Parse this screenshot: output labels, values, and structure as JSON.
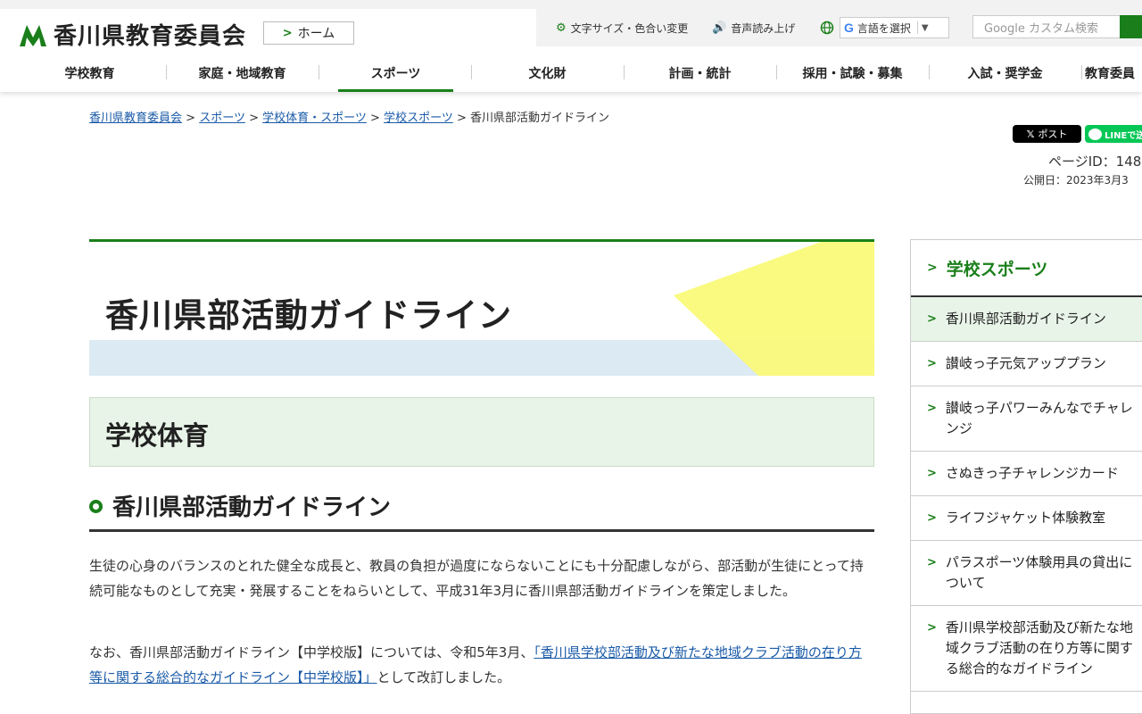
{
  "header": {
    "site_name": "香川県教育委員会",
    "home_label": "ホーム",
    "util": {
      "text_size": "文字サイズ・色合い変更",
      "read_aloud": "音声読み上げ",
      "language": "言語を選択",
      "language_caret": "▼",
      "search_placeholder": "Google カスタム検索"
    },
    "nav": [
      "学校教育",
      "家庭・地域教育",
      "スポーツ",
      "文化財",
      "計画・統計",
      "採用・試験・募集",
      "入試・奨学金",
      "教育委員"
    ]
  },
  "breadcrumb": {
    "items": [
      "香川県教育委員会",
      "スポーツ",
      "学校体育・スポーツ",
      "学校スポーツ"
    ],
    "sep": ">",
    "current": "香川県部活動ガイドライン"
  },
  "sns": {
    "x_label": "ポスト",
    "line_label": "LINEで送る"
  },
  "meta": {
    "page_id": "ページID：148",
    "published": "公開日：2023年3月3"
  },
  "main": {
    "page_title": "香川県部活動ガイドライン",
    "category": "学校体育",
    "heading": "香川県部活動ガイドライン",
    "paragraph1": "生徒の心身のバランスのとれた健全な成長と、教員の負担が過度にならないことにも十分配慮しながら、部活動が生徒にとって持続可能なものとして充実・発展することをねらいとして、平成31年3月に香川県部活動ガイドラインを策定しました。",
    "paragraph2_pre": "なお、香川県部活動ガイドライン【中学校版】については、令和5年3月、",
    "paragraph2_link": "「香川県学校部活動及び新たな地域クラブ活動の在り方等に関する総合的なガイドライン【中学校版】」",
    "paragraph2_post": "として改訂しました。"
  },
  "sidenav": {
    "title": "学校スポーツ",
    "items": [
      "香川県部活動ガイドライン",
      "讃岐っ子元気アッププラン",
      "讃岐っ子パワーみんなでチャレンジ",
      "さぬきっ子チャレンジカード",
      "ライフジャケット体験教室",
      "パラスポーツ体験用具の貸出について",
      "香川県学校部活動及び新たな地域クラブ活動の在り方等に関する総合的なガイドライン"
    ]
  },
  "colors": {
    "accent": "#1a7f1a",
    "link": "#1a5aa8",
    "title_band": "#dceaf3",
    "title_yellow": "#fafa7a"
  }
}
